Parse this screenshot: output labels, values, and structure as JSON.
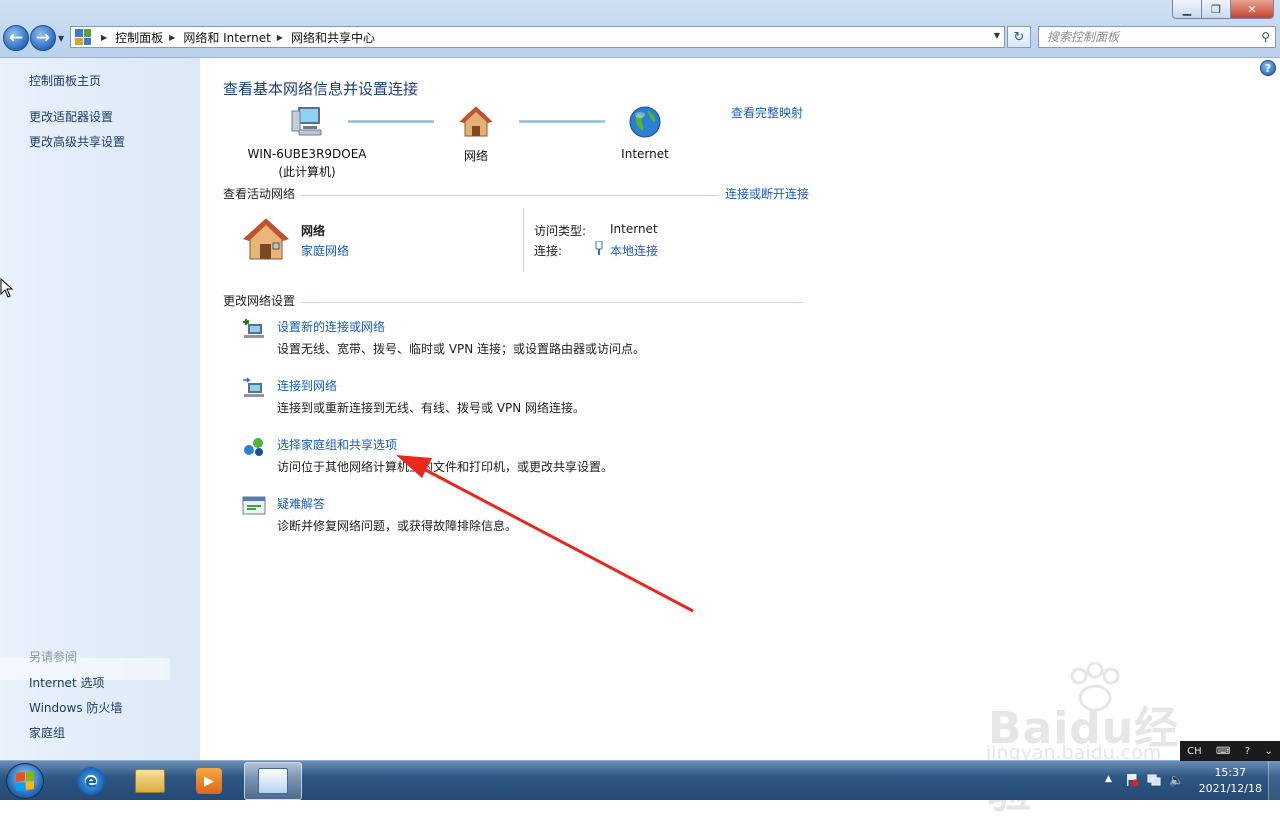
{
  "window": {
    "search_placeholder": "搜索控制面板",
    "breadcrumbs": [
      "控制面板",
      "网络和 Internet",
      "网络和共享中心"
    ]
  },
  "sidebar": {
    "home": "控制面板主页",
    "links": [
      "更改适配器设置",
      "更改高级共享设置"
    ],
    "see_also_header": "另请参阅",
    "see_also": [
      "Internet 选项",
      "Windows 防火墙",
      "家庭组"
    ]
  },
  "main": {
    "title": "查看基本网络信息并设置连接",
    "view_full_map": "查看完整映射",
    "map": {
      "computer_name": "WIN-6UBE3R9DOEA",
      "computer_sub": "(此计算机)",
      "network": "网络",
      "internet": "Internet"
    },
    "active_networks": {
      "header": "查看活动网络",
      "connect_disconnect": "连接或断开连接",
      "network_name": "网络",
      "network_type": "家庭网络",
      "access_type_label": "访问类型:",
      "access_type_value": "Internet",
      "connections_label": "连接:",
      "connections_value": "本地连接"
    },
    "change_settings": {
      "header": "更改网络设置",
      "tasks": [
        {
          "link": "设置新的连接或网络",
          "desc": "设置无线、宽带、拨号、临时或 VPN 连接；或设置路由器或访问点。"
        },
        {
          "link": "连接到网络",
          "desc": "连接到或重新连接到无线、有线、拨号或 VPN 网络连接。"
        },
        {
          "link": "选择家庭组和共享选项",
          "desc": "访问位于其他网络计算机上的文件和打印机，或更改共享设置。"
        },
        {
          "link": "疑难解答",
          "desc": "诊断并修复网络问题，或获得故障排除信息。"
        }
      ]
    }
  },
  "watermark": {
    "brand": "Baidu经验",
    "url": "jingyan.baidu.com"
  },
  "taskbar": {
    "tray_lang": "CH",
    "time": "15:37",
    "date": "2021/12/18"
  },
  "colors": {
    "link": "#1a5ec2",
    "title": "#1e3f7c",
    "annotation_arrow": "#e8281e"
  }
}
